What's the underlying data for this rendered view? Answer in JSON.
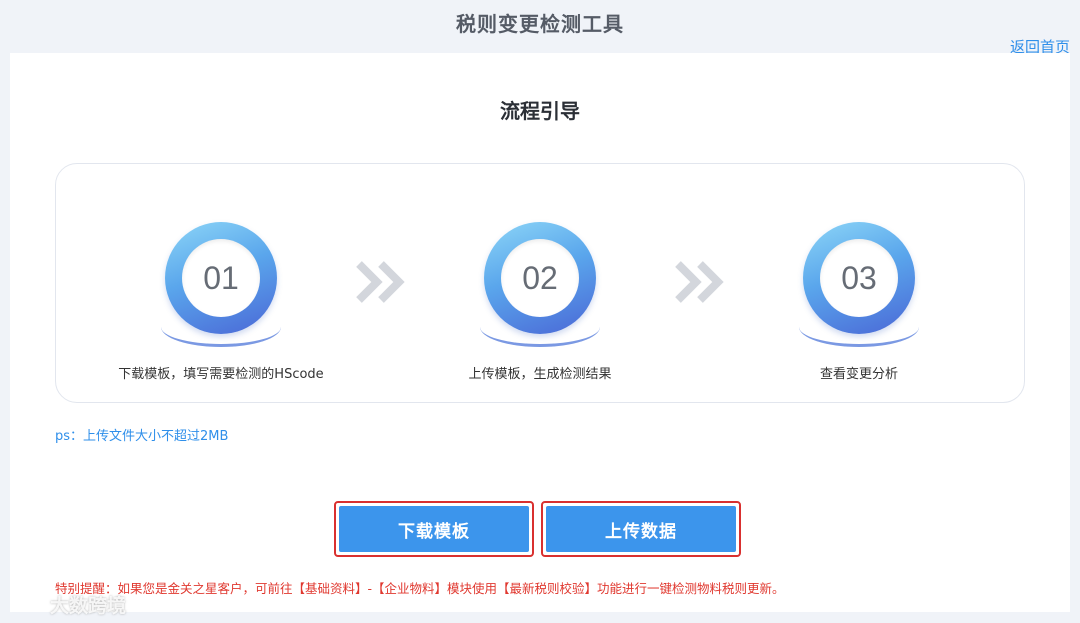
{
  "app": {
    "title": "税则变更检测工具",
    "back_link": "返回首页"
  },
  "guide": {
    "title": "流程引导",
    "steps": [
      {
        "number": "01",
        "label": "下载模板，填写需要检测的HScode"
      },
      {
        "number": "02",
        "label": "上传模板，生成检测结果"
      },
      {
        "number": "03",
        "label": "查看变更分析"
      }
    ]
  },
  "ps_note": "ps：上传文件大小不超过2MB",
  "buttons": {
    "download_template": "下载模板",
    "upload_data": "上传数据"
  },
  "notice": "特别提醒：如果您是金关之星客户，可前往【基础资料】-【企业物料】模块使用【最新税则校验】功能进行一键检测物料税则更新。",
  "watermark": "大数跨境",
  "colors": {
    "accent": "#3c95ec",
    "highlight_border": "#d9302f",
    "notice": "#e0382f"
  }
}
